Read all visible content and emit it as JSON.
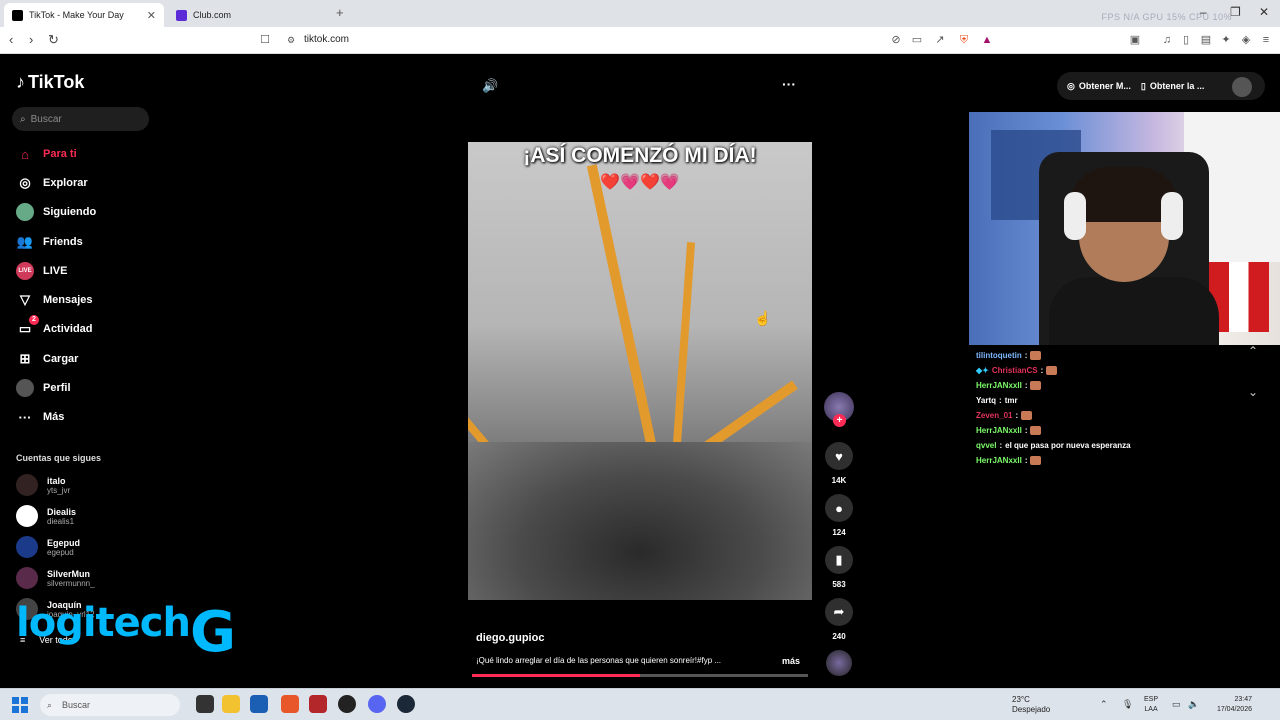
{
  "browser": {
    "tabs": [
      {
        "label": "TikTok - Make Your Day",
        "active": true
      },
      {
        "label": "Club.com",
        "active": false
      }
    ],
    "sys_stats": "FPS N/A   GPU 15%   CPU 10%",
    "url": "tiktok.com"
  },
  "sidebar": {
    "logo": "TikTok",
    "search_placeholder": "Buscar",
    "nav": [
      {
        "label": "Para ti",
        "icon": "home-icon",
        "active": true
      },
      {
        "label": "Explorar",
        "icon": "compass-icon"
      },
      {
        "label": "Siguiendo",
        "icon": "avatar-icon"
      },
      {
        "label": "Friends",
        "icon": "people-icon"
      },
      {
        "label": "LIVE",
        "icon": "live-icon"
      },
      {
        "label": "Mensajes",
        "icon": "send-icon"
      },
      {
        "label": "Actividad",
        "icon": "bell-icon",
        "badge": "2"
      },
      {
        "label": "Cargar",
        "icon": "plus-box-icon"
      },
      {
        "label": "Perfil",
        "icon": "user-icon"
      },
      {
        "label": "Más",
        "icon": "more-icon"
      }
    ],
    "following_title": "Cuentas que sigues",
    "following": [
      {
        "name": "italo",
        "handle": "yts_jvr",
        "color": "#332222"
      },
      {
        "name": "Diealis",
        "handle": "diealis1",
        "color": "#ffffff"
      },
      {
        "name": "Egepud",
        "handle": "egepud",
        "color": "#1b3a8a"
      },
      {
        "name": "SilverMun",
        "handle": "silvermunnn_",
        "color": "#5a2a4a"
      },
      {
        "name": "Joaquín",
        "handle": "joaquin_vrl12",
        "color": "#444444"
      }
    ],
    "see_all": "Ver todo",
    "overlay_logo": "logitech",
    "overlay_g": "G"
  },
  "video": {
    "title_text": "¡ASÍ COMENZÓ MI DÍA!",
    "hearts": "❤️💗❤️💗",
    "username": "diego.gupioc",
    "caption": "¡Qué lindo arreglar el día de las personas que quieren sonreír!#fyp ...",
    "more": "más",
    "progress_fraction": 0.5
  },
  "actions": {
    "likes": "14K",
    "comments": "124",
    "saves": "583",
    "shares": "240"
  },
  "topright": {
    "btn1": "Obtener M...",
    "btn2": "Obtener la ..."
  },
  "chat": [
    {
      "user": "tilintoquetin",
      "msg": "",
      "color": "#7fb8ff",
      "emote": true
    },
    {
      "user": "ChristianCS",
      "msg": "",
      "color": "#e2325a",
      "emote": true
    },
    {
      "user": "HerrJANxxII",
      "msg": "",
      "color": "#7cfc6a",
      "emote": true
    },
    {
      "user": "Yartq",
      "msg": "tmr",
      "color": "#ffffff",
      "emote": false
    },
    {
      "user": "Zeven_01",
      "msg": "",
      "color": "#e2325a",
      "emote": true
    },
    {
      "user": "HerrJANxxII",
      "msg": "",
      "color": "#7cfc6a",
      "emote": true
    },
    {
      "user": "qvvel",
      "msg": "el que pasa por nueva esperanza",
      "color": "#7cfc6a",
      "emote": false
    },
    {
      "user": "HerrJANxxII",
      "msg": "",
      "color": "#7cfc6a",
      "emote": true
    }
  ],
  "taskbar": {
    "search": "Buscar",
    "temp": "23°C",
    "weather": "Despejado",
    "lang1": "ESP",
    "lang2": "LAA",
    "time": "23:47",
    "date": "17/04/2026"
  }
}
